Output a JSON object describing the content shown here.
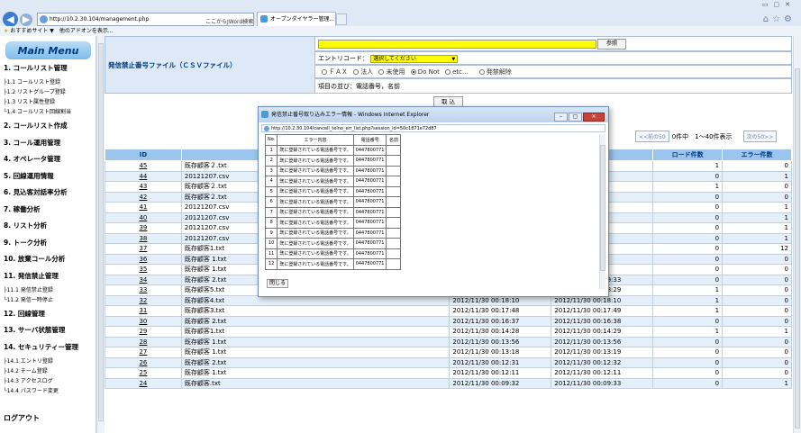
{
  "browser": {
    "address": "http://10.2.30.104/management.php",
    "search_hint": "ここからJWord検索",
    "tabs": [
      "ここからJWord検索",
      "オープンダイヤラー管理..."
    ],
    "favorites": [
      "おすすめサイト ▼",
      "他のアドオンを表示..."
    ]
  },
  "sidebar": {
    "title": "Main Menu",
    "sections": [
      {
        "label": "1. コールリスト管理",
        "children": [
          "├1.1 コールリスト登録",
          "├1.2 リストグループ登録",
          "├1.3 リスト属性登録",
          "└1.4 コールリスト回線割当"
        ]
      },
      {
        "label": "2. コールリスト作成",
        "children": []
      },
      {
        "label": "3. コール運用管理",
        "children": []
      },
      {
        "label": "4. オペレータ管理",
        "children": []
      },
      {
        "label": "5. 回線運用情報",
        "children": []
      },
      {
        "label": "6. 見込客対話率分析",
        "children": []
      },
      {
        "label": "7. 稼働分析",
        "children": []
      },
      {
        "label": "8. リスト分析",
        "children": []
      },
      {
        "label": "9. トーク分析",
        "children": []
      },
      {
        "label": "10. 放棄コール分析",
        "children": []
      },
      {
        "label": "11. 発信禁止管理",
        "children": [
          "├11.1 発信禁止登録",
          "└11.2 発信一時停止"
        ]
      },
      {
        "label": "12. 回線管理",
        "children": []
      },
      {
        "label": "13. サーバ状態管理",
        "children": []
      },
      {
        "label": "14. セキュリティー管理",
        "children": [
          "├14.1 エントリ登録",
          "├14.2 チーム登録",
          "├14.3 アクセスログ",
          "└14.4 パスワード変更"
        ]
      }
    ],
    "logout": "ログアウト"
  },
  "form": {
    "label": "発信禁止番号ファイル（ＣＳＶファイル）",
    "browse": "参照",
    "entry_label": "エントリコード：",
    "entry_select": "選択してください",
    "options": [
      "ＦＡＸ",
      "法人",
      "未使用",
      "Do Not",
      "etc...",
      "発禁解除"
    ],
    "order_label": "項目の並び：電話番号，名前",
    "import": "取 込"
  },
  "pager": {
    "prev": "<<前の50",
    "status": "0件中　1〜40件表示",
    "next": "次の50>>"
  },
  "table": {
    "headers": [
      "ID",
      "",
      "",
      "",
      "ロード件数",
      "エラー件数"
    ],
    "rows": [
      [
        "45",
        "既存顧客２.txt",
        "",
        "3:41",
        "1",
        "0"
      ],
      [
        "44",
        "20121207.csv",
        "",
        "9:08",
        "0",
        "1"
      ],
      [
        "43",
        "既存顧客２.txt",
        "",
        "1:00",
        "1",
        "0"
      ],
      [
        "42",
        "既存顧客２.txt",
        "",
        "3:38",
        "0",
        "0"
      ],
      [
        "41",
        "20121207.csv",
        "",
        "6:38",
        "0",
        "1"
      ],
      [
        "40",
        "20121207.csv",
        "",
        "8:54",
        "0",
        "1"
      ],
      [
        "39",
        "20121207.csv",
        "",
        "9:46",
        "0",
        "1"
      ],
      [
        "38",
        "20121207.csv",
        "",
        "5:43",
        "0",
        "1"
      ],
      [
        "37",
        "既存顧客1.txt",
        "",
        "5:18",
        "0",
        "12"
      ],
      [
        "36",
        "既存顧客 1.txt",
        "",
        "4:38",
        "0",
        "0"
      ],
      [
        "35",
        "既存顧客 1.txt",
        "",
        "3:56",
        "0",
        "0"
      ],
      [
        "34",
        "既存顧客 2.txt",
        "2012/12/06 15:59:32",
        "2012/12/06 15:59:33",
        "0",
        "0"
      ],
      [
        "33",
        "既存顧客5.txt",
        "2012/11/30 00:18:29",
        "2012/11/30 00:18:29",
        "1",
        "0"
      ],
      [
        "32",
        "既存顧客4.txt",
        "2012/11/30 00:18:10",
        "2012/11/30 00:18:10",
        "1",
        "0"
      ],
      [
        "31",
        "既存顧客3.txt",
        "2012/11/30 00:17:48",
        "2012/11/30 00:17:49",
        "1",
        "0"
      ],
      [
        "30",
        "既存顧客 2.txt",
        "2012/11/30 00:16:37",
        "2012/11/30 00:16:38",
        "0",
        "0"
      ],
      [
        "29",
        "既存顧客1.txt",
        "2012/11/30 00:14:28",
        "2012/11/30 00:14:29",
        "1",
        "1"
      ],
      [
        "28",
        "既存顧客 1.txt",
        "2012/11/30 00:13:56",
        "2012/11/30 00:13:56",
        "0",
        "0"
      ],
      [
        "27",
        "既存顧客 1.txt",
        "2012/11/30 00:13:18",
        "2012/11/30 00:13:19",
        "0",
        "0"
      ],
      [
        "26",
        "既存顧客 2.txt",
        "2012/11/30 00:12:31",
        "2012/11/30 00:12:32",
        "0",
        "0"
      ],
      [
        "25",
        "既存顧客 1.txt",
        "2012/11/30 00:12:11",
        "2012/11/30 00:12:11",
        "0",
        "0"
      ],
      [
        "24",
        "既存顧客.txt",
        "2012/11/30 00:09:32",
        "2012/11/30 00:09:33",
        "0",
        "1"
      ]
    ]
  },
  "popup": {
    "title": "発信禁止番号取り込みエラー情報 - Windows Internet Explorer",
    "address": "http://10.2.30.104/cancell_telno_err_list.php?session_id=50c1871e72d87",
    "headers": [
      "No.",
      "エラー内容",
      "電話番号",
      "名前"
    ],
    "rows": [
      [
        "1",
        "既に登録されている電話番号です。",
        "0447800771",
        ""
      ],
      [
        "2",
        "既に登録されている電話番号です。",
        "0447800771",
        ""
      ],
      [
        "3",
        "既に登録されている電話番号です。",
        "0447800771",
        ""
      ],
      [
        "4",
        "既に登録されている電話番号です。",
        "0447800771",
        ""
      ],
      [
        "5",
        "既に登録されている電話番号です。",
        "0447800771",
        ""
      ],
      [
        "6",
        "既に登録されている電話番号です。",
        "0447800771",
        ""
      ],
      [
        "7",
        "既に登録されている電話番号です。",
        "0447800771",
        ""
      ],
      [
        "8",
        "既に登録されている電話番号です。",
        "0447800771",
        ""
      ],
      [
        "9",
        "既に登録されている電話番号です。",
        "0447800771",
        ""
      ],
      [
        "10",
        "既に登録されている電話番号です。",
        "0447800771",
        ""
      ],
      [
        "11",
        "既に登録されている電話番号です。",
        "0447800771",
        ""
      ],
      [
        "12",
        "既に登録されている電話番号です。",
        "0447800771",
        ""
      ]
    ],
    "close": "閉じる"
  }
}
